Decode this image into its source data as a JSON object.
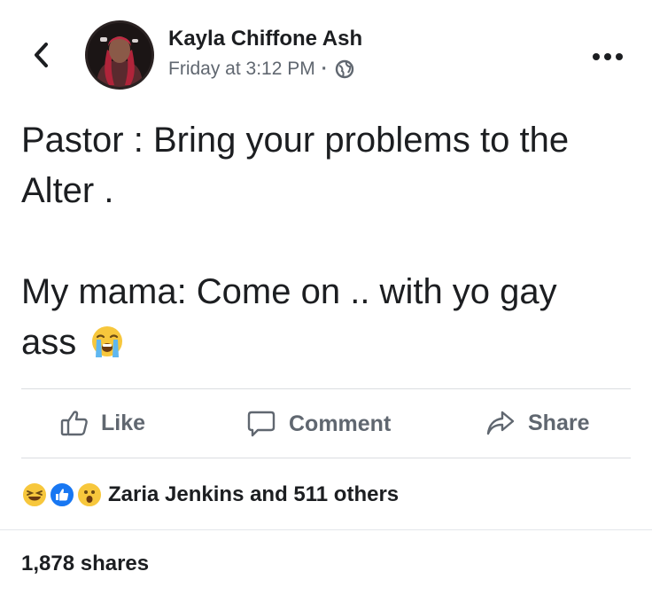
{
  "post": {
    "author": "Kayla Chiffone Ash",
    "timestamp": "Friday at 3:12 PM",
    "separator": "·",
    "privacy_icon": "globe-icon",
    "text_line1": "Pastor : Bring your problems to the",
    "text_line2": "Alter .",
    "text_line3": "My mama: Come on .. with yo gay",
    "text_line4": "ass",
    "trailing_emoji": "loudly-crying-face-emoji"
  },
  "actions": {
    "like_label": "Like",
    "comment_label": "Comment",
    "share_label": "Share"
  },
  "reactions": {
    "icons": [
      "laughing-face-emoji",
      "like-thumb-icon",
      "surprised-face-emoji"
    ],
    "summary": "Zaria Jenkins and 511 others"
  },
  "shares": {
    "label": "1,878 shares"
  },
  "colors": {
    "text_primary": "#1c1e21",
    "text_secondary": "#606770",
    "like_blue": "#1877f2",
    "reaction_yellow": "#f7c73c",
    "divider": "#dadde1"
  }
}
